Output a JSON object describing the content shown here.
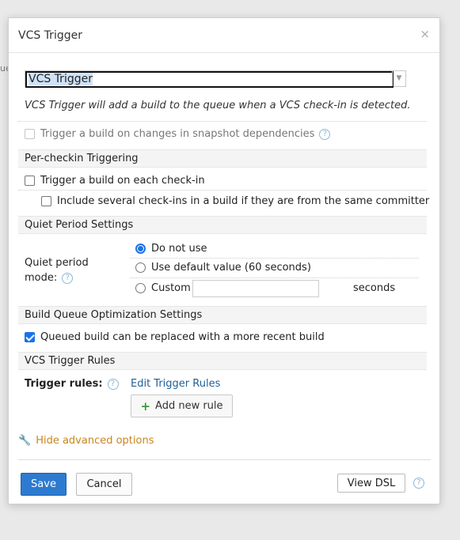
{
  "background": {
    "edge_text": "ue"
  },
  "dialog": {
    "title": "VCS Trigger",
    "close_glyph": "×",
    "trigger_select": {
      "value": "VCS Trigger"
    },
    "description": "VCS Trigger will add a build to the queue when a VCS check-in is detected.",
    "snapshot_deps": {
      "label": "Trigger a build on changes in snapshot dependencies",
      "checked": false,
      "disabled": true
    },
    "sections": {
      "per_checkin": "Per-checkin Triggering",
      "quiet_period": "Quiet Period Settings",
      "queue_opt": "Build Queue Optimization Settings",
      "rules": "VCS Trigger Rules"
    },
    "per_checkin": {
      "each_checkin": {
        "label": "Trigger a build on each check-in",
        "checked": false
      },
      "several_checkins": {
        "label": "Include several check-ins in a build if they are from the same committer",
        "checked": false
      }
    },
    "quiet_period": {
      "mode_label_line1": "Quiet period",
      "mode_label_line2": "mode:",
      "options": [
        "Do not use",
        "Use default value (60 seconds)",
        "Custom"
      ],
      "selected": "Do not use",
      "custom_value": "",
      "seconds_label": "seconds"
    },
    "queue_opt": {
      "replace_label": "Queued build can be replaced with a more recent build",
      "checked": true
    },
    "rules": {
      "label": "Trigger rules:",
      "edit_link": "Edit Trigger Rules",
      "add_button": "Add new rule"
    },
    "advanced_toggle": "Hide advanced options",
    "footer": {
      "save": "Save",
      "cancel": "Cancel",
      "view_dsl": "View DSL"
    }
  },
  "colors": {
    "accent": "#2d7bd0",
    "link": "#1f5f98",
    "advanced": "#c6861e",
    "plus": "#3a9a3a"
  },
  "icons": {
    "help": "question-circle-icon",
    "wrench": "wrench-icon",
    "plus": "plus-icon",
    "dropdown": "triangle-down-icon"
  }
}
